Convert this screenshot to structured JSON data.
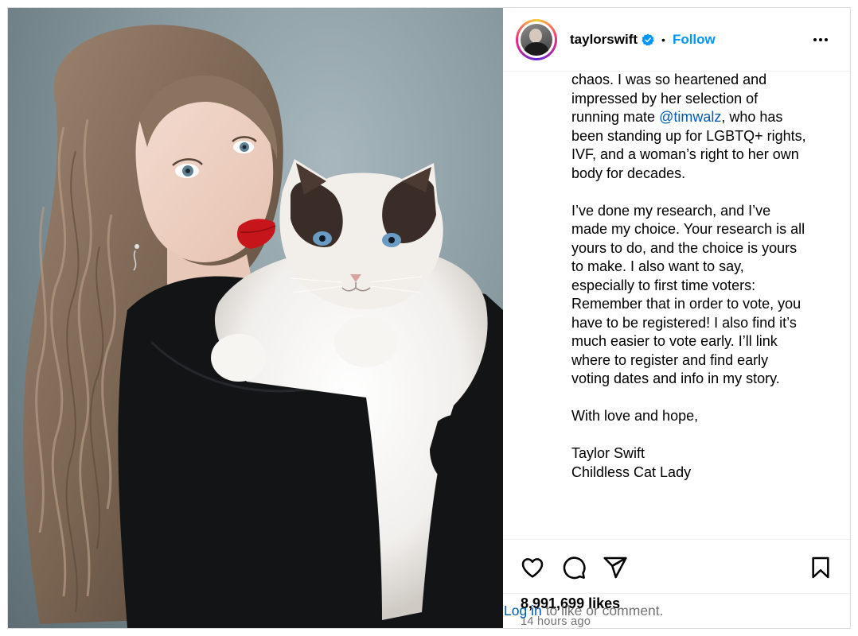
{
  "header": {
    "username": "taylorswift",
    "separator": "•",
    "follow_label": "Follow"
  },
  "caption": {
    "lines_1": [
      "chaos. I was so heartened and",
      "impressed by her selection of"
    ],
    "line_mention_prefix": "running mate ",
    "mention": "@timwalz",
    "line_mention_suffix": ", who has",
    "lines_2": [
      "been standing up for LGBTQ+ rights,",
      "IVF, and a woman’s right to her own",
      "body for decades."
    ],
    "paragraph_2": [
      "I’ve done my research, and I’ve",
      "made my choice. Your research is all",
      "yours to do, and the choice is yours",
      "to make. I also want to say,",
      "especially to first time voters:",
      "Remember that in order to vote, you",
      "have to be registered! I also find it’s",
      "much easier to vote early. I’ll link",
      "where to register and find early",
      "voting dates and info in my story."
    ],
    "closing": "With love and hope,",
    "signature_1": "Taylor Swift",
    "signature_2": "Childless Cat Lady"
  },
  "engagement": {
    "likes": "8,991,699 likes",
    "time": "14 hours ago"
  },
  "footer": {
    "login_link": "Log in",
    "login_text": "to like or comment."
  },
  "icons": {
    "like": "heart-icon",
    "comment": "comment-icon",
    "share": "share-icon",
    "save": "bookmark-icon",
    "more": "more-icon",
    "verified": "verified-badge-icon"
  },
  "colors": {
    "follow": "#0095f6",
    "mention": "#0059b3",
    "muted": "#737373",
    "verified": "#0095f6"
  }
}
